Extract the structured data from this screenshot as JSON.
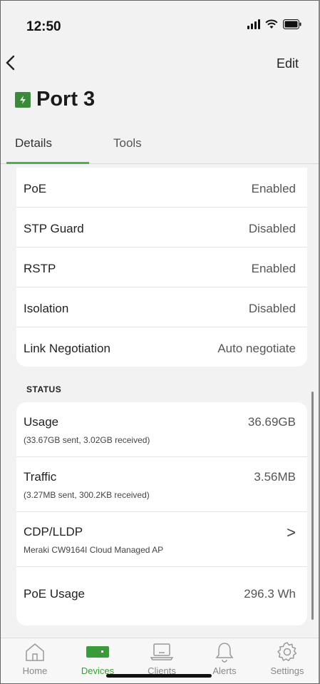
{
  "status_bar": {
    "time": "12:50"
  },
  "nav": {
    "back_icon": "chevron-left-icon",
    "edit_label": "Edit"
  },
  "page": {
    "title": "Port 3",
    "icon": "port-icon",
    "icon_color": "#3b8a3b"
  },
  "tabs": [
    {
      "label": "Details",
      "active": true
    },
    {
      "label": "Tools",
      "active": false
    }
  ],
  "settings_rows": [
    {
      "label": "PoE",
      "value": "Enabled"
    },
    {
      "label": "STP Guard",
      "value": "Disabled"
    },
    {
      "label": "RSTP",
      "value": "Enabled"
    },
    {
      "label": "Isolation",
      "value": "Disabled"
    },
    {
      "label": "Link Negotiation",
      "value": "Auto negotiate"
    }
  ],
  "status_section": {
    "heading": "STATUS",
    "rows": [
      {
        "label": "Usage",
        "value": "36.69GB",
        "sub": "(33.67GB sent, 3.02GB received)"
      },
      {
        "label": "Traffic",
        "value": "3.56MB",
        "sub": "(3.27MB sent, 300.2KB received)"
      },
      {
        "label": "CDP/LLDP",
        "sub": "Meraki CW9164I Cloud Managed AP",
        "chevron": ">"
      },
      {
        "label": "PoE Usage",
        "value": "296.3 Wh"
      }
    ]
  },
  "tab_bar": [
    {
      "label": "Home",
      "icon": "home-icon",
      "active": false
    },
    {
      "label": "Devices",
      "icon": "devices-icon",
      "active": true
    },
    {
      "label": "Clients",
      "icon": "laptop-icon",
      "active": false
    },
    {
      "label": "Alerts",
      "icon": "bell-icon",
      "active": false
    },
    {
      "label": "Settings",
      "icon": "gear-icon",
      "active": false
    }
  ],
  "colors": {
    "accent": "#3a9b3a",
    "tab_underline": "#4caf50"
  }
}
